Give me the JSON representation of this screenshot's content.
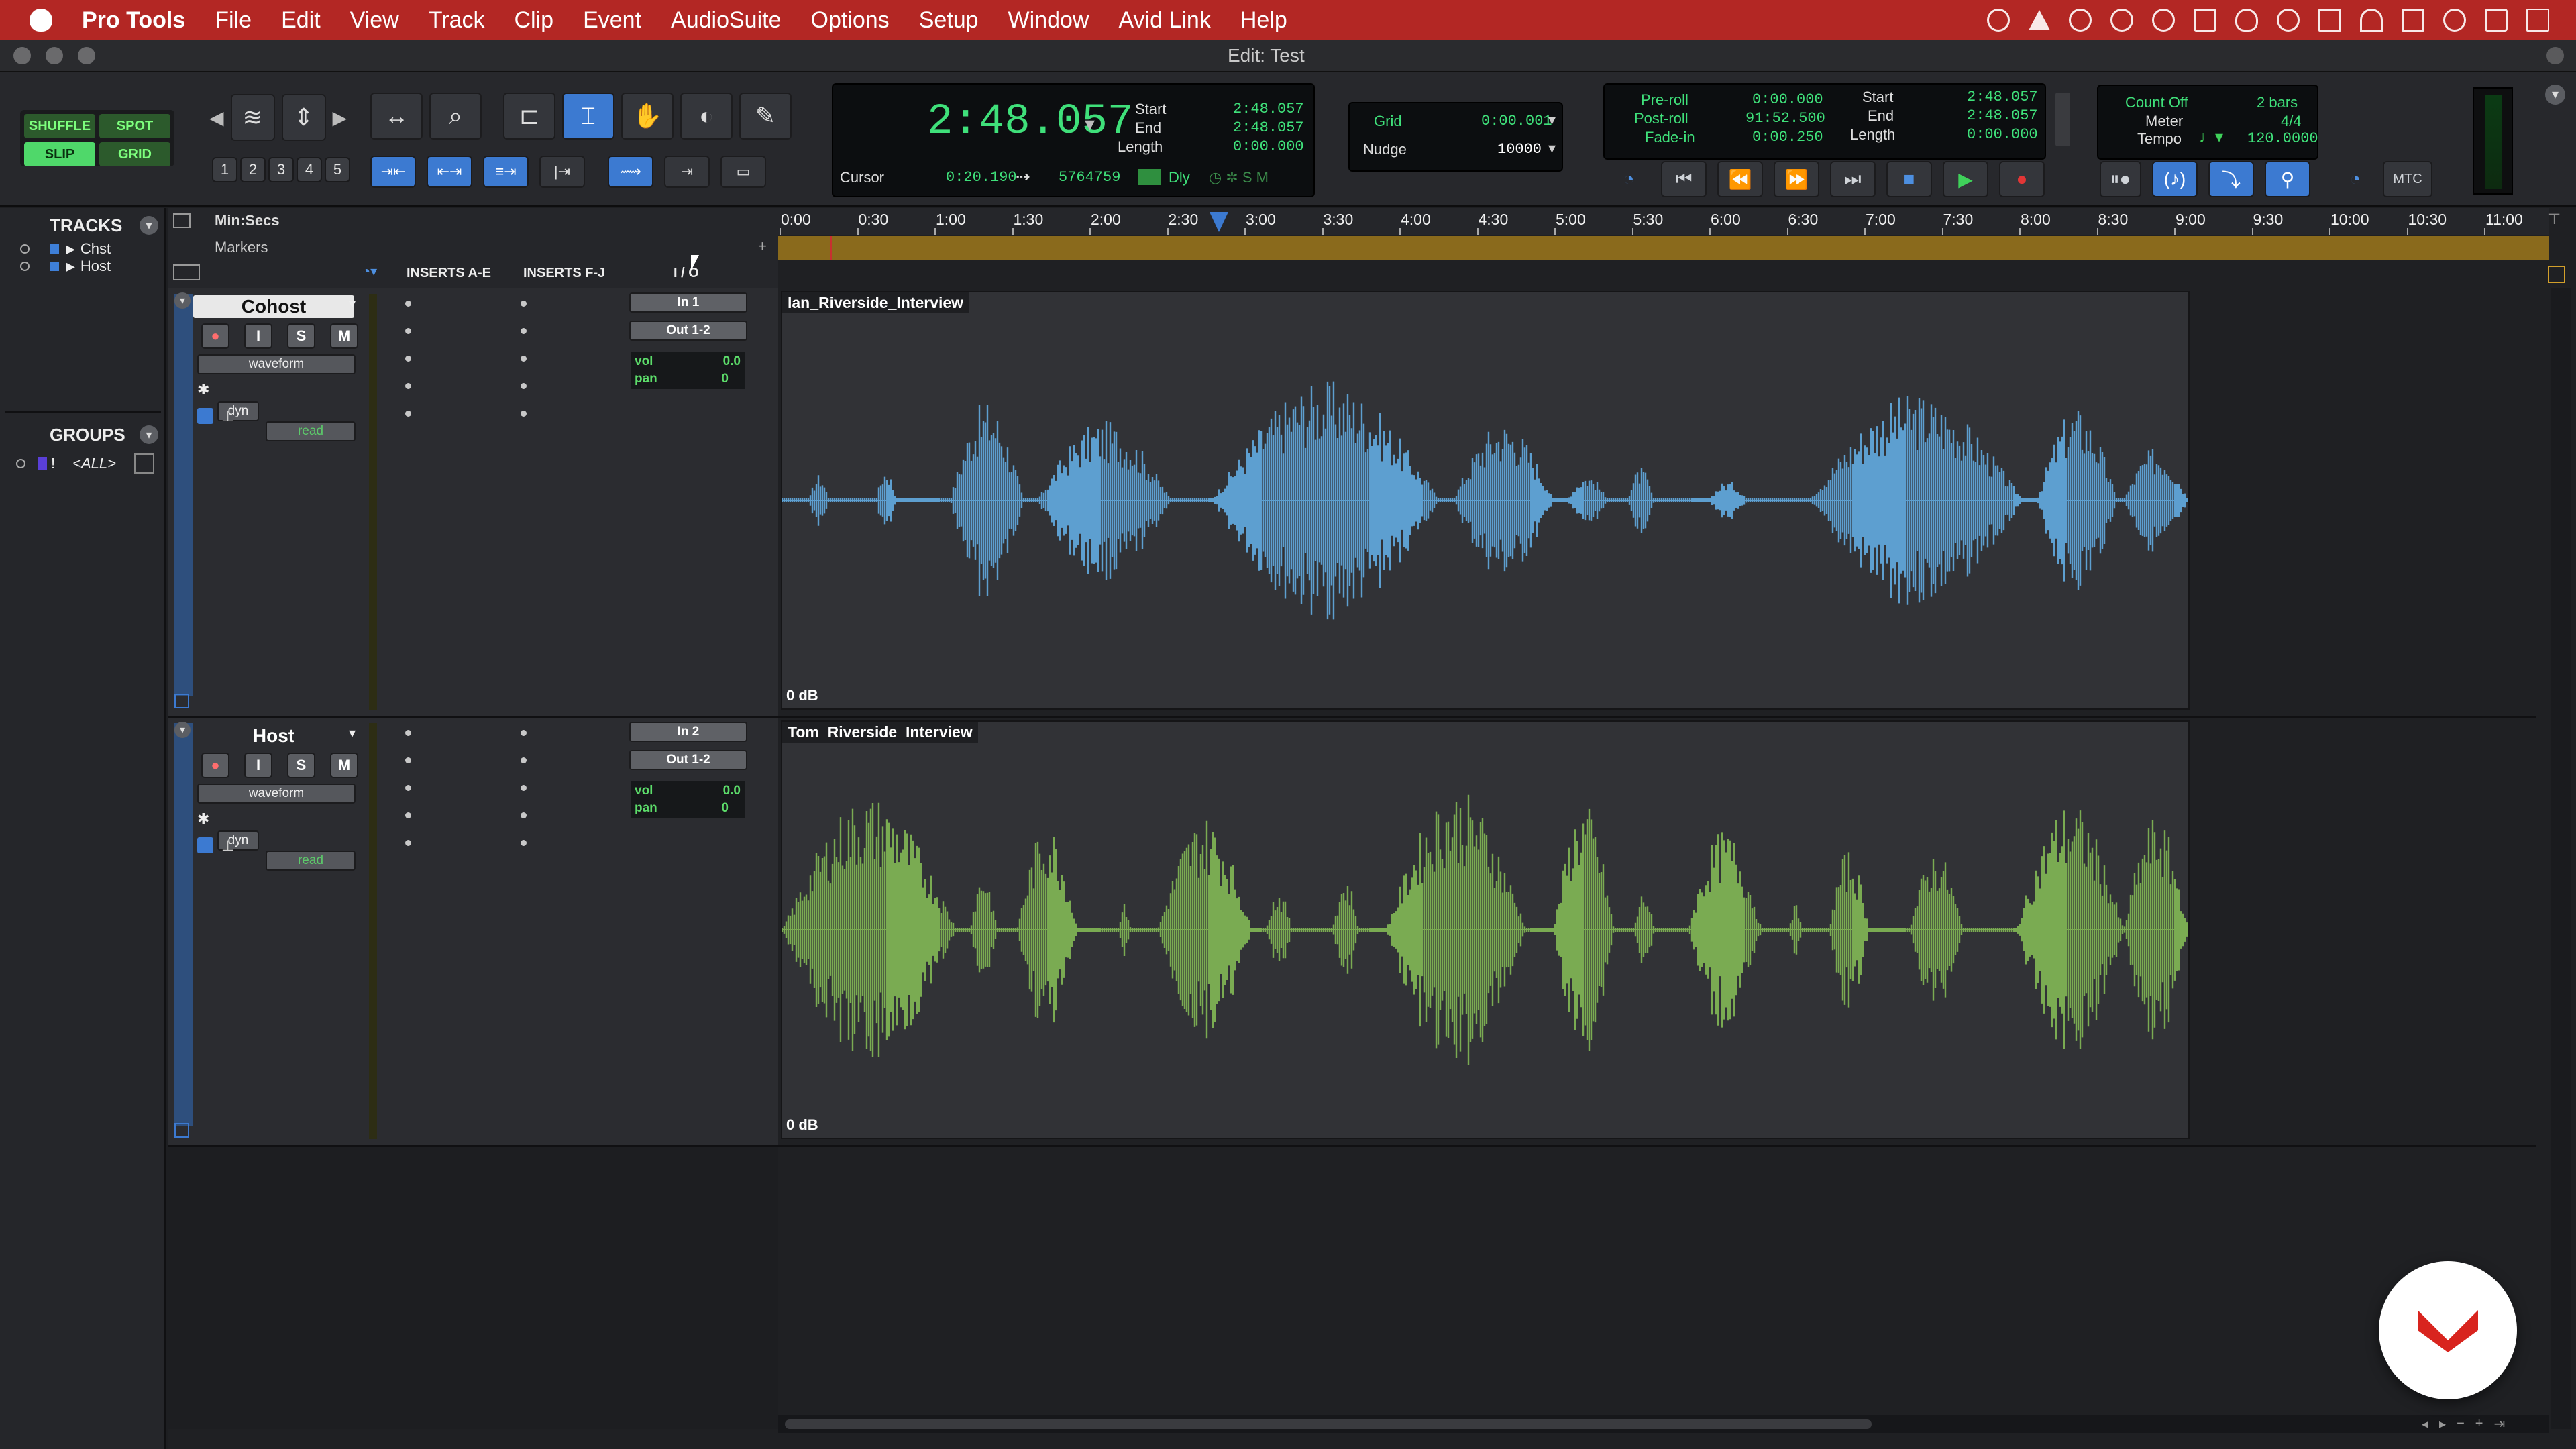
{
  "menubar": {
    "app_name": "Pro Tools",
    "items": [
      "File",
      "Edit",
      "View",
      "Track",
      "Clip",
      "Event",
      "AudioSuite",
      "Options",
      "Setup",
      "Window",
      "Avid Link",
      "Help"
    ]
  },
  "window": {
    "title": "Edit: Test"
  },
  "edit_modes": {
    "shuffle": "SHUFFLE",
    "spot": "SPOT",
    "slip": "SLIP",
    "grid": "GRID"
  },
  "zoom_presets": [
    "1",
    "2",
    "3",
    "4",
    "5"
  ],
  "counter": {
    "main": "2:48.057",
    "start_label": "Start",
    "start_value": "2:48.057",
    "end_label": "End",
    "end_value": "2:48.057",
    "length_label": "Length",
    "length_value": "0:00.000",
    "cursor_label": "Cursor",
    "cursor_value": "0:20.190",
    "sample_value": "5764759",
    "dly_label": "Dly"
  },
  "grid": {
    "label": "Grid",
    "value": "0:00.001",
    "nudge_label": "Nudge",
    "nudge_value": "10000"
  },
  "prepost": {
    "preroll_label": "Pre-roll",
    "preroll_value": "0:00.000",
    "postroll_label": "Post-roll",
    "postroll_value": "91:52.500",
    "fadein_label": "Fade-in",
    "fadein_value": "0:00.250",
    "start_label": "Start",
    "start_value": "2:48.057",
    "end_label": "End",
    "end_value": "2:48.057",
    "length_label": "Length",
    "length_value": "0:00.000"
  },
  "tempo": {
    "countoff_label": "Count Off",
    "countoff_value": "2 bars",
    "meter_label": "Meter",
    "meter_value": "4/4",
    "tempo_label": "Tempo",
    "tempo_value": "120.0000",
    "mtc_label": "MTC"
  },
  "tracks_panel": {
    "header": "TRACKS",
    "items": [
      {
        "name": "Chst"
      },
      {
        "name": "Host"
      }
    ]
  },
  "groups_panel": {
    "header": "GROUPS",
    "items": [
      {
        "name": "<ALL>"
      }
    ]
  },
  "ruler": {
    "timebase_label": "Min:Secs",
    "markers_label": "Markers",
    "ticks": [
      "0:00",
      "0:30",
      "1:00",
      "1:30",
      "2:00",
      "2:30",
      "3:00",
      "3:30",
      "4:00",
      "4:30",
      "5:00",
      "5:30",
      "6:00",
      "6:30",
      "7:00",
      "7:30",
      "8:00",
      "8:30",
      "9:00",
      "9:30",
      "10:00",
      "10:30",
      "11:00"
    ]
  },
  "column_headers": {
    "inserts_ae": "INSERTS A-E",
    "inserts_fj": "INSERTS F-J",
    "io": "I / O"
  },
  "tracks": [
    {
      "name": "Cohost",
      "view": "waveform",
      "dyn": "dyn",
      "automation": "read",
      "input": "In 1",
      "output": "Out 1-2",
      "vol_label": "vol",
      "vol_value": "0.0",
      "pan_label": "pan",
      "pan_value": "0",
      "clip_name": "Ian_Riverside_Interview",
      "clip_gain": "0 dB",
      "color": "#5d9fd0"
    },
    {
      "name": "Host",
      "view": "waveform",
      "dyn": "dyn",
      "automation": "read",
      "input": "In 2",
      "output": "Out 1-2",
      "vol_label": "vol",
      "vol_value": "0.0",
      "pan_label": "pan",
      "pan_value": "0",
      "clip_name": "Tom_Riverside_Interview",
      "clip_gain": "0 dB",
      "color": "#7aab52"
    }
  ],
  "track_buttons": {
    "record": "●",
    "input": "I",
    "solo": "S",
    "mute": "M"
  },
  "colors": {
    "menubar": "#b32724",
    "selection_blue": "#3c7ad1",
    "marker_bar": "#8a6a1c",
    "cohost_wave": "#5d9fd0",
    "host_wave": "#7aab52"
  }
}
